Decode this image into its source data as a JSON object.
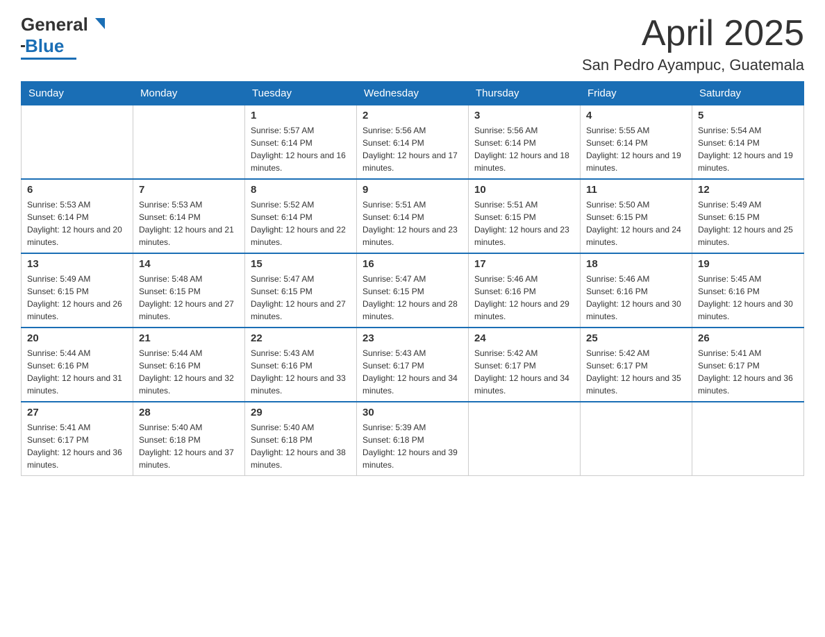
{
  "header": {
    "logo_text_general": "General",
    "logo_text_blue": "Blue",
    "month_title": "April 2025",
    "location": "San Pedro Ayampuc, Guatemala"
  },
  "weekdays": [
    "Sunday",
    "Monday",
    "Tuesday",
    "Wednesday",
    "Thursday",
    "Friday",
    "Saturday"
  ],
  "weeks": [
    [
      {
        "day": "",
        "sunrise": "",
        "sunset": "",
        "daylight": ""
      },
      {
        "day": "",
        "sunrise": "",
        "sunset": "",
        "daylight": ""
      },
      {
        "day": "1",
        "sunrise": "Sunrise: 5:57 AM",
        "sunset": "Sunset: 6:14 PM",
        "daylight": "Daylight: 12 hours and 16 minutes."
      },
      {
        "day": "2",
        "sunrise": "Sunrise: 5:56 AM",
        "sunset": "Sunset: 6:14 PM",
        "daylight": "Daylight: 12 hours and 17 minutes."
      },
      {
        "day": "3",
        "sunrise": "Sunrise: 5:56 AM",
        "sunset": "Sunset: 6:14 PM",
        "daylight": "Daylight: 12 hours and 18 minutes."
      },
      {
        "day": "4",
        "sunrise": "Sunrise: 5:55 AM",
        "sunset": "Sunset: 6:14 PM",
        "daylight": "Daylight: 12 hours and 19 minutes."
      },
      {
        "day": "5",
        "sunrise": "Sunrise: 5:54 AM",
        "sunset": "Sunset: 6:14 PM",
        "daylight": "Daylight: 12 hours and 19 minutes."
      }
    ],
    [
      {
        "day": "6",
        "sunrise": "Sunrise: 5:53 AM",
        "sunset": "Sunset: 6:14 PM",
        "daylight": "Daylight: 12 hours and 20 minutes."
      },
      {
        "day": "7",
        "sunrise": "Sunrise: 5:53 AM",
        "sunset": "Sunset: 6:14 PM",
        "daylight": "Daylight: 12 hours and 21 minutes."
      },
      {
        "day": "8",
        "sunrise": "Sunrise: 5:52 AM",
        "sunset": "Sunset: 6:14 PM",
        "daylight": "Daylight: 12 hours and 22 minutes."
      },
      {
        "day": "9",
        "sunrise": "Sunrise: 5:51 AM",
        "sunset": "Sunset: 6:14 PM",
        "daylight": "Daylight: 12 hours and 23 minutes."
      },
      {
        "day": "10",
        "sunrise": "Sunrise: 5:51 AM",
        "sunset": "Sunset: 6:15 PM",
        "daylight": "Daylight: 12 hours and 23 minutes."
      },
      {
        "day": "11",
        "sunrise": "Sunrise: 5:50 AM",
        "sunset": "Sunset: 6:15 PM",
        "daylight": "Daylight: 12 hours and 24 minutes."
      },
      {
        "day": "12",
        "sunrise": "Sunrise: 5:49 AM",
        "sunset": "Sunset: 6:15 PM",
        "daylight": "Daylight: 12 hours and 25 minutes."
      }
    ],
    [
      {
        "day": "13",
        "sunrise": "Sunrise: 5:49 AM",
        "sunset": "Sunset: 6:15 PM",
        "daylight": "Daylight: 12 hours and 26 minutes."
      },
      {
        "day": "14",
        "sunrise": "Sunrise: 5:48 AM",
        "sunset": "Sunset: 6:15 PM",
        "daylight": "Daylight: 12 hours and 27 minutes."
      },
      {
        "day": "15",
        "sunrise": "Sunrise: 5:47 AM",
        "sunset": "Sunset: 6:15 PM",
        "daylight": "Daylight: 12 hours and 27 minutes."
      },
      {
        "day": "16",
        "sunrise": "Sunrise: 5:47 AM",
        "sunset": "Sunset: 6:15 PM",
        "daylight": "Daylight: 12 hours and 28 minutes."
      },
      {
        "day": "17",
        "sunrise": "Sunrise: 5:46 AM",
        "sunset": "Sunset: 6:16 PM",
        "daylight": "Daylight: 12 hours and 29 minutes."
      },
      {
        "day": "18",
        "sunrise": "Sunrise: 5:46 AM",
        "sunset": "Sunset: 6:16 PM",
        "daylight": "Daylight: 12 hours and 30 minutes."
      },
      {
        "day": "19",
        "sunrise": "Sunrise: 5:45 AM",
        "sunset": "Sunset: 6:16 PM",
        "daylight": "Daylight: 12 hours and 30 minutes."
      }
    ],
    [
      {
        "day": "20",
        "sunrise": "Sunrise: 5:44 AM",
        "sunset": "Sunset: 6:16 PM",
        "daylight": "Daylight: 12 hours and 31 minutes."
      },
      {
        "day": "21",
        "sunrise": "Sunrise: 5:44 AM",
        "sunset": "Sunset: 6:16 PM",
        "daylight": "Daylight: 12 hours and 32 minutes."
      },
      {
        "day": "22",
        "sunrise": "Sunrise: 5:43 AM",
        "sunset": "Sunset: 6:16 PM",
        "daylight": "Daylight: 12 hours and 33 minutes."
      },
      {
        "day": "23",
        "sunrise": "Sunrise: 5:43 AM",
        "sunset": "Sunset: 6:17 PM",
        "daylight": "Daylight: 12 hours and 34 minutes."
      },
      {
        "day": "24",
        "sunrise": "Sunrise: 5:42 AM",
        "sunset": "Sunset: 6:17 PM",
        "daylight": "Daylight: 12 hours and 34 minutes."
      },
      {
        "day": "25",
        "sunrise": "Sunrise: 5:42 AM",
        "sunset": "Sunset: 6:17 PM",
        "daylight": "Daylight: 12 hours and 35 minutes."
      },
      {
        "day": "26",
        "sunrise": "Sunrise: 5:41 AM",
        "sunset": "Sunset: 6:17 PM",
        "daylight": "Daylight: 12 hours and 36 minutes."
      }
    ],
    [
      {
        "day": "27",
        "sunrise": "Sunrise: 5:41 AM",
        "sunset": "Sunset: 6:17 PM",
        "daylight": "Daylight: 12 hours and 36 minutes."
      },
      {
        "day": "28",
        "sunrise": "Sunrise: 5:40 AM",
        "sunset": "Sunset: 6:18 PM",
        "daylight": "Daylight: 12 hours and 37 minutes."
      },
      {
        "day": "29",
        "sunrise": "Sunrise: 5:40 AM",
        "sunset": "Sunset: 6:18 PM",
        "daylight": "Daylight: 12 hours and 38 minutes."
      },
      {
        "day": "30",
        "sunrise": "Sunrise: 5:39 AM",
        "sunset": "Sunset: 6:18 PM",
        "daylight": "Daylight: 12 hours and 39 minutes."
      },
      {
        "day": "",
        "sunrise": "",
        "sunset": "",
        "daylight": ""
      },
      {
        "day": "",
        "sunrise": "",
        "sunset": "",
        "daylight": ""
      },
      {
        "day": "",
        "sunrise": "",
        "sunset": "",
        "daylight": ""
      }
    ]
  ]
}
